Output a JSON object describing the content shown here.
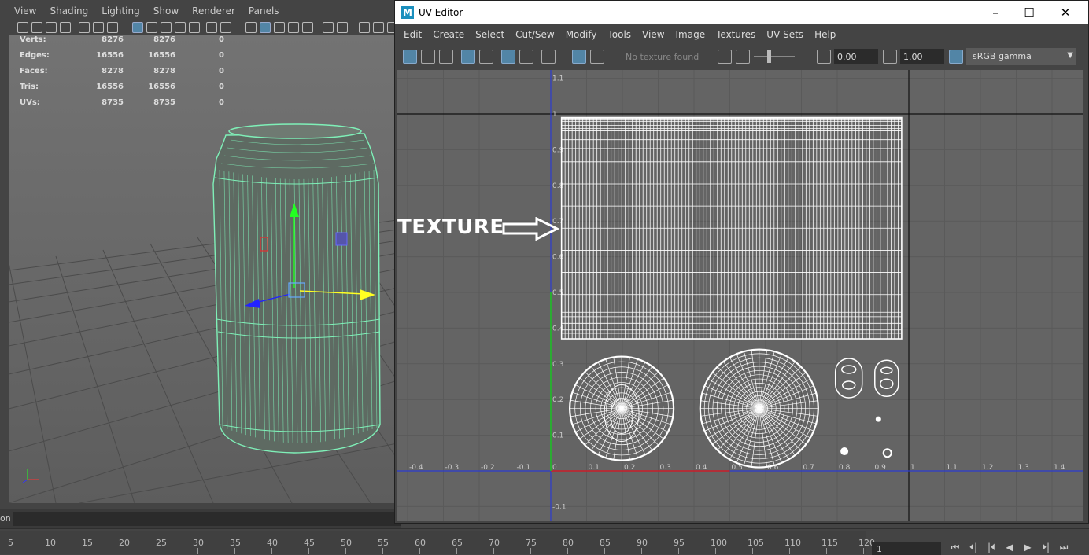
{
  "viewport": {
    "menu": [
      "View",
      "Shading",
      "Lighting",
      "Show",
      "Renderer",
      "Panels"
    ],
    "hud": [
      {
        "label": "Verts:",
        "a": "8276",
        "b": "8276",
        "c": "0"
      },
      {
        "label": "Edges:",
        "a": "16556",
        "b": "16556",
        "c": "0"
      },
      {
        "label": "Faces:",
        "a": "8278",
        "b": "8278",
        "c": "0"
      },
      {
        "label": "Tris:",
        "a": "16556",
        "b": "16556",
        "c": "0"
      },
      {
        "label": "UVs:",
        "a": "8735",
        "b": "8735",
        "c": "0"
      }
    ]
  },
  "cmdline": {
    "label": "on"
  },
  "timeline": {
    "ticks": [
      "5",
      "10",
      "15",
      "20",
      "25",
      "30",
      "35",
      "40",
      "45",
      "50",
      "55",
      "60",
      "65",
      "70",
      "75",
      "80",
      "85",
      "90",
      "95",
      "100",
      "105",
      "110",
      "115",
      "120"
    ],
    "current_frame": "1",
    "playback": [
      "⏮",
      "⏴|",
      "|⏴",
      "◀",
      "▶",
      "⏵|",
      "⏭"
    ]
  },
  "uv_editor": {
    "title": "UV Editor",
    "logo": "M",
    "controls": {
      "minimize": "–",
      "maximize": "☐",
      "close": "✕"
    },
    "menu": [
      "Edit",
      "Create",
      "Select",
      "Cut/Sew",
      "Modify",
      "Tools",
      "View",
      "Image",
      "Textures",
      "UV Sets",
      "Help"
    ],
    "no_texture": "No texture found",
    "exposure": "0.00",
    "gamma": "1.00",
    "color_space": "sRGB gamma",
    "x_ticks": [
      "-0.4",
      "-0.3",
      "-0.2",
      "-0.1",
      "0",
      "0.1",
      "0.2",
      "0.3",
      "0.4",
      "0.5",
      "0.6",
      "0.7",
      "0.8",
      "0.9",
      "1",
      "1.1",
      "1.2",
      "1.3",
      "1.4"
    ],
    "y_ticks": [
      "1.1",
      "1",
      "0.9",
      "0.8",
      "0.7",
      "0.6",
      "0.5",
      "0.4",
      "0.3",
      "0.2",
      "0.1",
      "-0.1"
    ]
  },
  "annotation": {
    "text": "TEXTURE"
  },
  "colors": {
    "wire": "#7ff0b8",
    "uv_wire": "#ffffff",
    "accent": "#5285a6",
    "canvas": "#646464"
  }
}
